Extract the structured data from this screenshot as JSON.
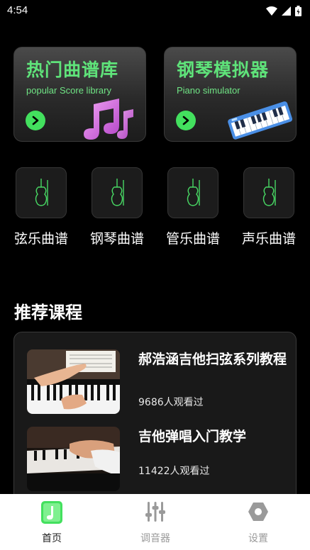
{
  "status": {
    "time": "4:54"
  },
  "cards": [
    {
      "title": "热门曲谱库",
      "subtitle": "popular Score library"
    },
    {
      "title": "钢琴模拟器",
      "subtitle": "Piano simulator"
    }
  ],
  "categories": [
    {
      "label": "弦乐曲谱"
    },
    {
      "label": "钢琴曲谱"
    },
    {
      "label": "管乐曲谱"
    },
    {
      "label": "声乐曲谱"
    }
  ],
  "section": {
    "title": "推荐课程"
  },
  "courses": [
    {
      "title": "郝浩涵吉他扫弦系列教程",
      "views": "9686人观看过"
    },
    {
      "title": "吉他弹唱入门教学",
      "views": "11422人观看过"
    }
  ],
  "tabs": [
    {
      "label": "首页",
      "icon": "home-icon",
      "active": true
    },
    {
      "label": "调音器",
      "icon": "tuner-icon",
      "active": false
    },
    {
      "label": "设置",
      "icon": "settings-icon",
      "active": false
    }
  ],
  "colors": {
    "accent": "#43e05e",
    "background": "#000000",
    "card": "#2a2a2a",
    "tab_active": "#222222",
    "tab_inactive": "#9a9a9a"
  }
}
